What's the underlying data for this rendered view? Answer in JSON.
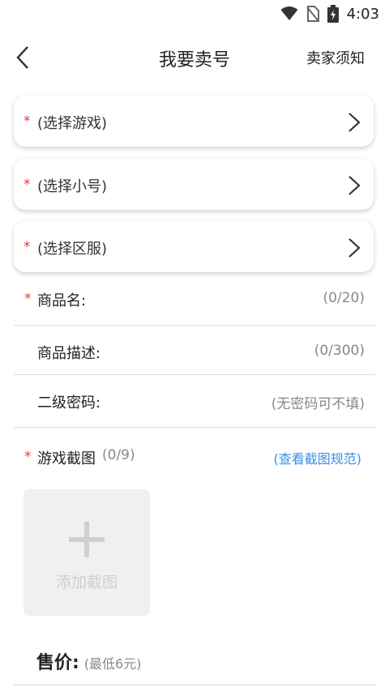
{
  "status_bar": {
    "time": "4:03"
  },
  "header": {
    "title": "我要卖号",
    "notice_label": "卖家须知"
  },
  "selectors": [
    {
      "required": "*",
      "label": "(选择游戏)"
    },
    {
      "required": "*",
      "label": "(选择小号)"
    },
    {
      "required": "*",
      "label": "(选择区服)"
    }
  ],
  "fields": {
    "product_name": {
      "required": "*",
      "label": "商品名:",
      "counter": "(0/20)"
    },
    "description": {
      "label": "商品描述:",
      "counter": "(0/300)"
    },
    "secondary_password": {
      "label": "二级密码:",
      "placeholder": "(无密码可不填)"
    }
  },
  "screenshots": {
    "required": "*",
    "label": "游戏截图",
    "count": "(0/9)",
    "rules_link": "(查看截图规范)",
    "add_label": "添加截图"
  },
  "price": {
    "label": "售价:",
    "hint": "(最低6元)"
  },
  "colors": {
    "required": "#e53935",
    "link": "#3b8ee6"
  }
}
